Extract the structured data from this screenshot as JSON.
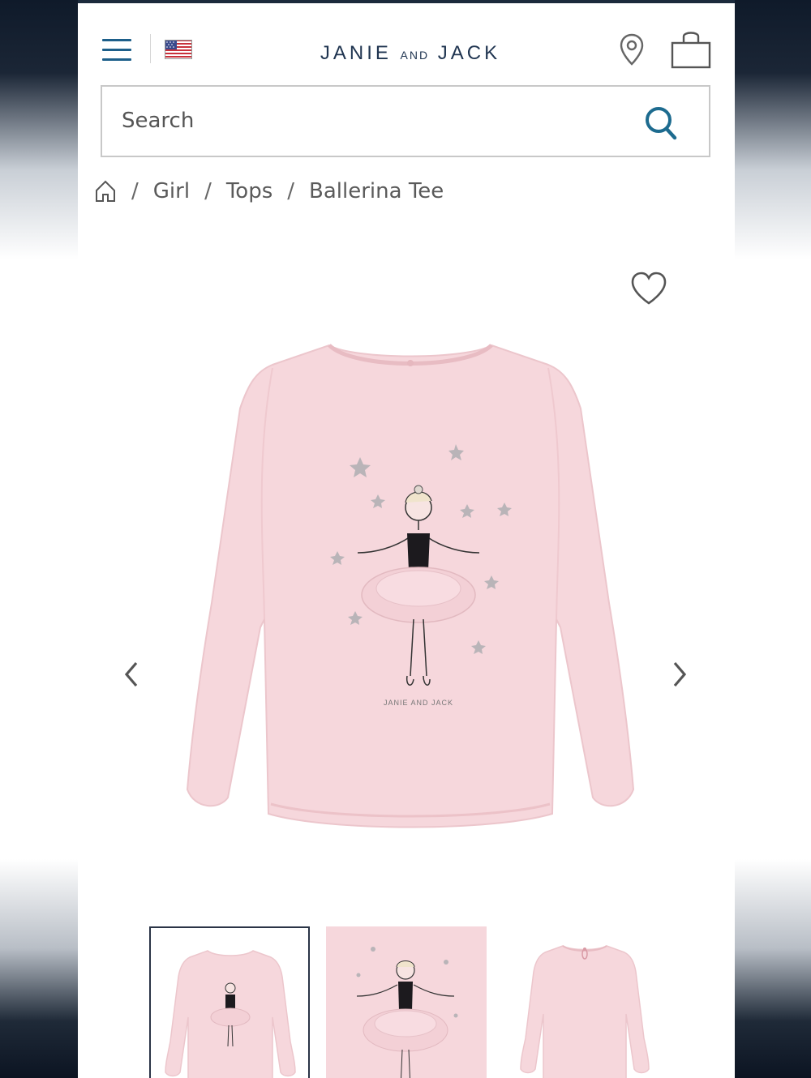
{
  "header": {
    "brand_main_1": "JANIE",
    "brand_small": "AND",
    "brand_main_2": "JACK",
    "menu_icon": "hamburger-icon",
    "flag_icon": "us-flag-icon",
    "location_icon": "map-pin-icon",
    "bag_icon": "shopping-bag-icon"
  },
  "search": {
    "placeholder": "Search",
    "icon": "search-icon"
  },
  "breadcrumb": {
    "home_icon": "home-icon",
    "items": [
      "Girl",
      "Tops",
      "Ballerina Tee"
    ],
    "separator": "/"
  },
  "product": {
    "print_brand": "JANIE AND JACK",
    "wishlist_icon": "heart-icon",
    "prev_icon": "chevron-left-icon",
    "next_icon": "chevron-right-icon",
    "shirt_color": "#f6d7dc"
  },
  "thumbnails": {
    "count": 3,
    "active_index": 0
  },
  "colors": {
    "accent": "#1d5f8a",
    "brand_text": "#1f3450"
  }
}
